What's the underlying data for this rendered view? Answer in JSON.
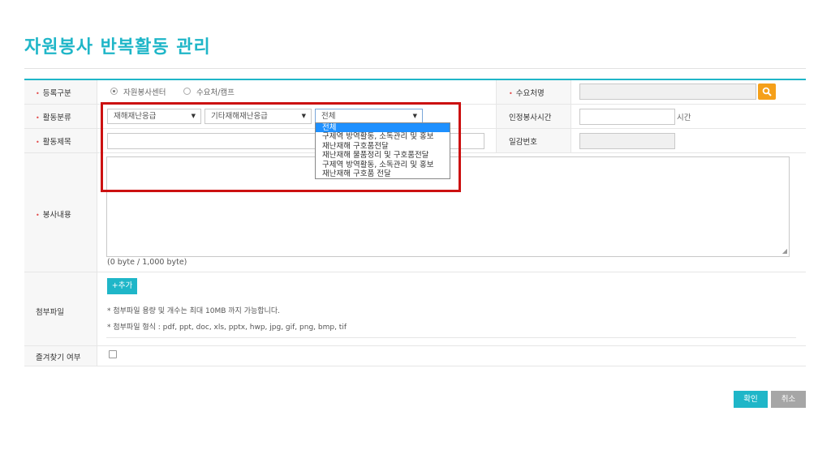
{
  "page": {
    "title": "자원봉사 반복활동 관리"
  },
  "form": {
    "registration_type": {
      "label": "등록구분",
      "options": [
        "자원봉사센터",
        "수요처/캠프"
      ],
      "selected_index": 0
    },
    "demand_name": {
      "label": "수요처명",
      "value": ""
    },
    "activity_category": {
      "label": "활동분류",
      "select1": "재해재난응급",
      "select2": "기타재해재난응급",
      "select3": "전체",
      "dropdown_options": [
        "전체",
        "구제역 방역활동, 소독관리 및 홍보",
        "재난재해 구호품전달",
        "재난재해 물품정리 및 구호품전달",
        "구제역 방역활동, 소독관리 및 홍보",
        "재난재해 구호품 전달"
      ],
      "dropdown_selected_index": 0
    },
    "recognized_hours": {
      "label": "인정봉사시간",
      "value": "",
      "unit": "시간"
    },
    "activity_title": {
      "label": "활동제목",
      "value": ""
    },
    "serial_number": {
      "label": "일감번호",
      "value": ""
    },
    "service_content": {
      "label": "봉사내용",
      "value": "",
      "byte_counter": "(0 byte / 1,000 byte)"
    },
    "attachment": {
      "label": "첨부파일",
      "add_button": "+추가",
      "notes": [
        "* 첨부파일 용량 및 개수는 최대 10MB 까지 가능합니다.",
        "* 첨부파일 형식 : pdf, ppt, doc, xls, pptx, hwp, jpg, gif, png, bmp, tif"
      ]
    },
    "favorite": {
      "label": "즐겨찾기 여부",
      "checked": false
    }
  },
  "buttons": {
    "confirm": "확인",
    "cancel": "취소"
  },
  "colors": {
    "accent": "#1fb6c8",
    "search": "#f5a01a",
    "highlight": "#cc1111",
    "selected_option": "#1e90ff"
  },
  "icons": {
    "search": "search-icon",
    "select_arrow": "dropdown-arrow-icon",
    "required": "required-dot-icon"
  }
}
